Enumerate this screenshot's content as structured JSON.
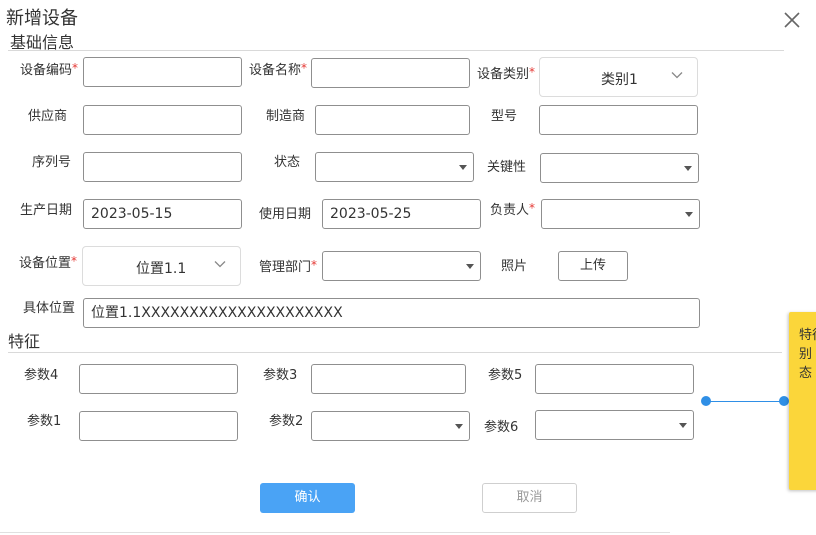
{
  "dialog": {
    "title": "新增设备",
    "close_label": "×"
  },
  "basic": {
    "title": "基础信息",
    "code_label": "设备编码",
    "code_value": "",
    "name_label": "设备名称",
    "name_value": "",
    "category_label": "设备类别",
    "category_value": "类别1",
    "supplier_label": "供应商",
    "supplier_value": "",
    "manufacturer_label": "制造商",
    "manufacturer_value": "",
    "model_label": "型号",
    "model_value": "",
    "serial_label": "序列号",
    "serial_value": "",
    "status_label": "状态",
    "status_value": "",
    "criticality_label": "关键性",
    "criticality_value": "",
    "production_date_label": "生产日期",
    "production_date_value": "2023-05-15",
    "use_date_label": "使用日期",
    "use_date_value": "2023-05-25",
    "owner_label": "负责人",
    "owner_value": "",
    "location_label": "设备位置",
    "location_value": "位置1.1",
    "department_label": "管理部门",
    "department_value": "",
    "photo_label": "照片",
    "upload_label": "上传",
    "detail_location_label": "具体位置",
    "detail_location_value": "位置1.1XXXXXXXXXXXXXXXXXXXXX"
  },
  "features": {
    "title": "特征",
    "param4_label": "参数4",
    "param4_value": "",
    "param3_label": "参数3",
    "param3_value": "",
    "param5_label": "参数5",
    "param5_value": "",
    "param1_label": "参数1",
    "param1_value": "",
    "param2_label": "参数2",
    "param2_value": "",
    "param6_label": "参数6",
    "param6_value": ""
  },
  "buttons": {
    "confirm": "确认",
    "cancel": "取消"
  },
  "note": {
    "line1": "特征",
    "line2": "别",
    "line3": "态"
  },
  "colors": {
    "required": "#e53935",
    "primary": "#4aa3f5",
    "note": "#fbd63a",
    "connector": "#2f8fe6"
  },
  "icons": {
    "close": "close-icon",
    "dropdown": "caret-down-icon",
    "chevron": "chevron-down-icon"
  }
}
